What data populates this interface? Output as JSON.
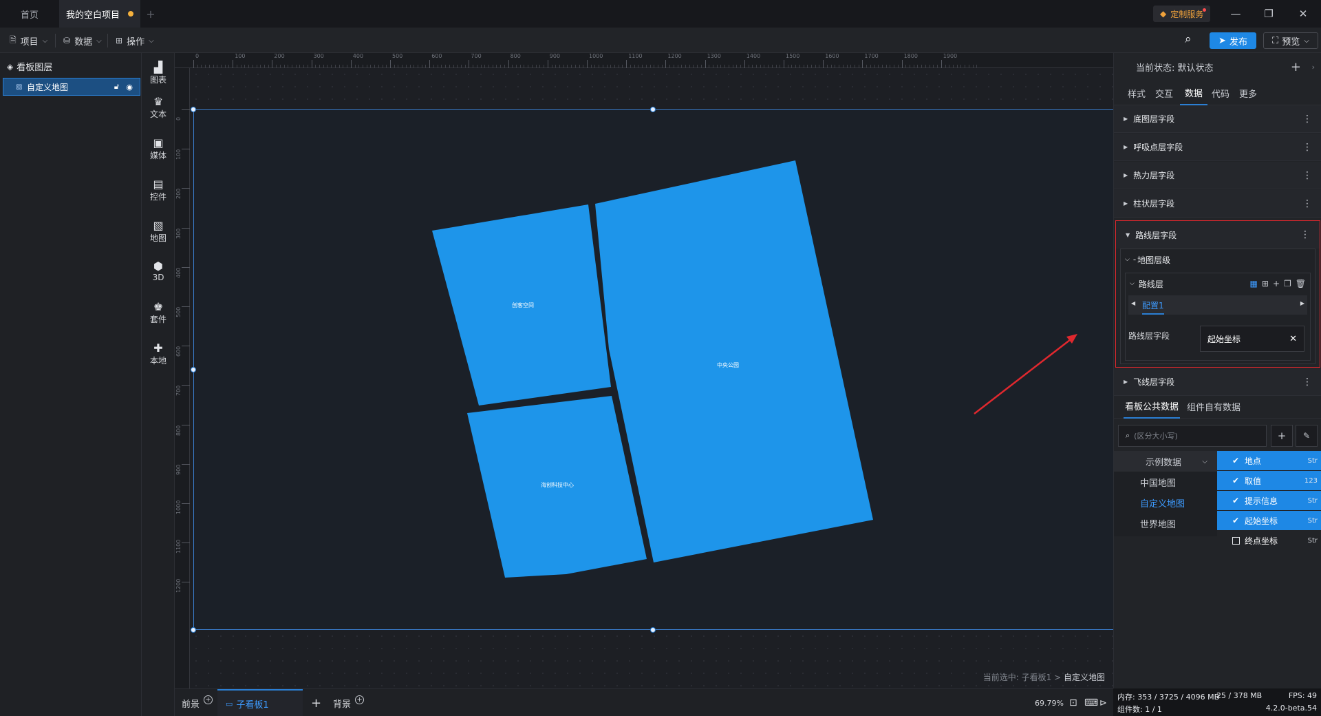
{
  "tabs": {
    "home": "首页",
    "project": "我的空白项目"
  },
  "window": {
    "custom_service": "定制服务"
  },
  "toolbar": {
    "project": "项目",
    "data": "数据",
    "operate": "操作",
    "publish": "发布",
    "preview": "预览"
  },
  "layers": {
    "title": "看板图层",
    "item": "自定义地图"
  },
  "components": [
    "图表",
    "文本",
    "媒体",
    "控件",
    "地图",
    "3D",
    "套件",
    "本地"
  ],
  "ruler": {
    "h_ticks": [
      "0",
      "100",
      "200",
      "300",
      "400",
      "500",
      "600",
      "700",
      "800",
      "900",
      "1000",
      "1100",
      "1200",
      "1300",
      "1400",
      "1500",
      "1600",
      "1700",
      "1800",
      "1900"
    ],
    "v_ticks": [
      "0",
      "100",
      "200",
      "300",
      "400",
      "500",
      "600",
      "700",
      "800",
      "900",
      "1000",
      "1100",
      "1200"
    ]
  },
  "map": {
    "regions": [
      "创客空间",
      "中央公园",
      "海创科技中心"
    ],
    "fill_color": "#1e95ea"
  },
  "canvas": {
    "current_prefix": "当前选中: 子看板1 >",
    "current_target": "自定义地图"
  },
  "bottom": {
    "front": "前景",
    "sub_board": "子看板1",
    "background": "背景",
    "zoom": "69.79%"
  },
  "status": {
    "memory": "内存: 353 / 3725 / 4096 MB",
    "mem2": "25 / 378 MB",
    "fps": "FPS: 49",
    "components": "组件数: 1 / 1",
    "version": "4.2.0-beta.54"
  },
  "right": {
    "state": "当前状态: 默认状态",
    "tabs": [
      "样式",
      "交互",
      "数据",
      "代码",
      "更多"
    ],
    "sections": [
      "底图层字段",
      "呼吸点层字段",
      "热力层字段",
      "柱状层字段",
      "路线层字段",
      "飞线层字段"
    ],
    "map_layer": "地图层级",
    "route_layer": "路线层",
    "config": "配置1",
    "route_field_label": "路线层字段",
    "route_field_value": "起始坐标",
    "data_tabs": [
      "看板公共数据",
      "组件自有数据"
    ],
    "search_placeholder": "(区分大小写)",
    "datasets": [
      "示例数据",
      "中国地图",
      "自定义地图",
      "世界地图"
    ],
    "fields": [
      {
        "name": "地点",
        "type": "Str",
        "checked": true
      },
      {
        "name": "取值",
        "type": "123",
        "checked": true
      },
      {
        "name": "提示信息",
        "type": "Str",
        "checked": true
      },
      {
        "name": "起始坐标",
        "type": "Str",
        "checked": true
      },
      {
        "name": "终点坐标",
        "type": "Str",
        "checked": false
      }
    ]
  },
  "colors": {
    "accent": "#1e88e5",
    "highlight_box": "#e0282e",
    "arrow": "#e0282e"
  }
}
